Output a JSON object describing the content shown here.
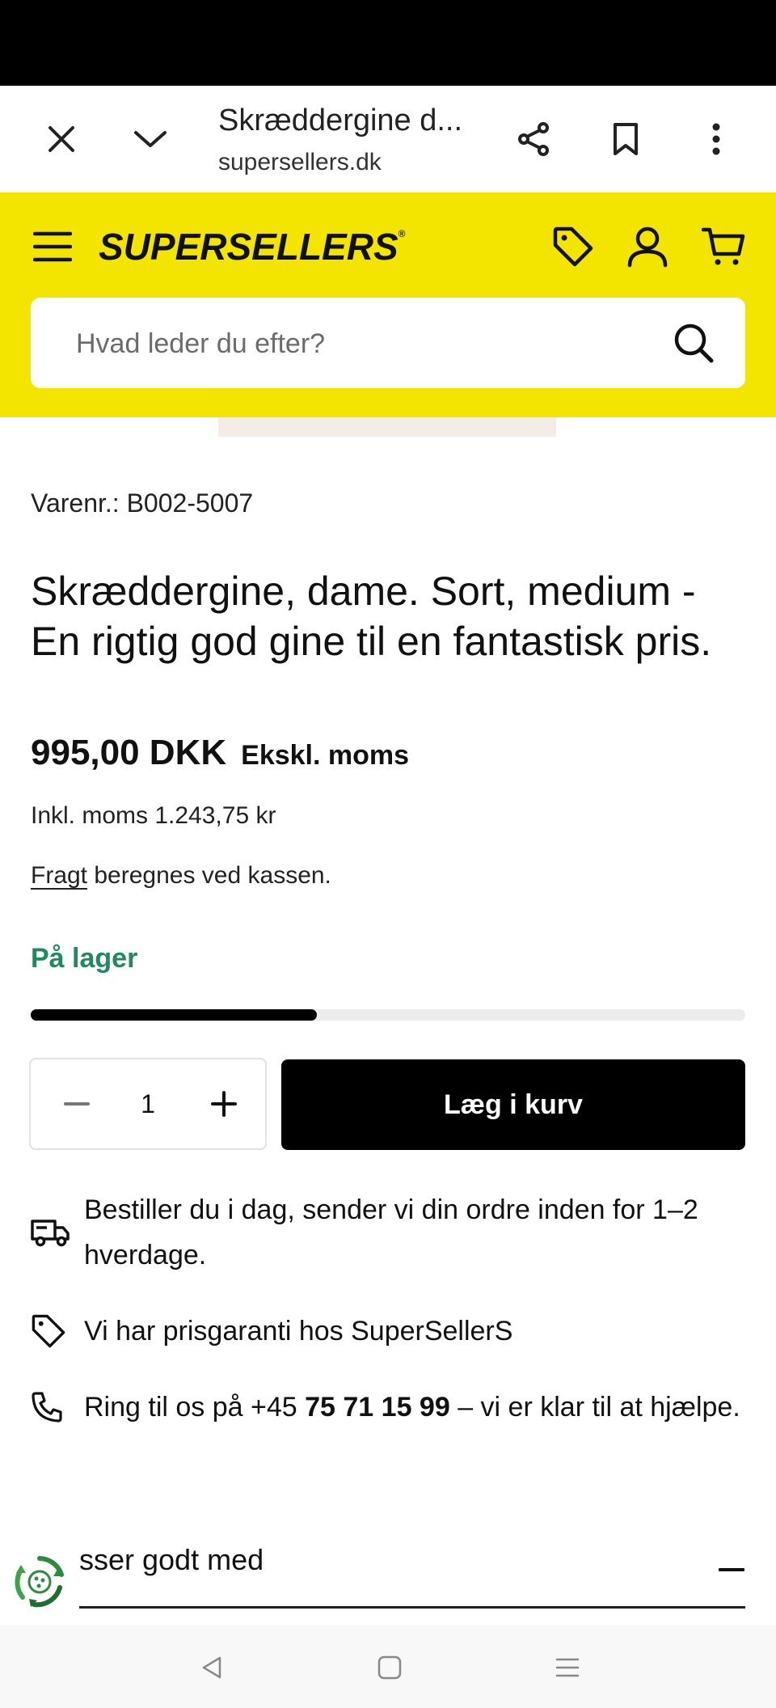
{
  "browser": {
    "tab_title": "Skræddergine d...",
    "url": "supersellers.dk"
  },
  "site": {
    "logo_text": "SUPERSELLERS",
    "logo_sup": "®",
    "search_placeholder": "Hvad leder du efter?"
  },
  "product": {
    "sku": "Varenr.: B002-5007",
    "title": "Skræddergine, dame. Sort, medium - En rigtig god gine til en fantastisk pris.",
    "price": "995,00 DKK",
    "price_note": "Ekskl. moms",
    "price_incl": "Inkl. moms 1.243,75 kr",
    "shipping_link": "Fragt",
    "shipping_text": " beregnes ved kassen.",
    "stock_status": "På lager",
    "stock_level": 0.4,
    "quantity": "1",
    "add_to_cart": "Læg i kurv"
  },
  "info": {
    "delivery": "Bestiller du i dag, sender vi din ordre inden for 1–2 hverdage.",
    "guarantee": "Vi har prisgaranti hos SuperSellerS",
    "phone_prefix": "Ring til os på +45 ",
    "phone_number": "75 71 15 99",
    "phone_suffix": " – vi er klar til at hjælpe."
  },
  "accordion": {
    "label": "sser godt med",
    "toggle": "−"
  },
  "colors": {
    "brand_yellow": "#f4e501",
    "stock_green": "#1e8a5e",
    "black": "#000000"
  }
}
